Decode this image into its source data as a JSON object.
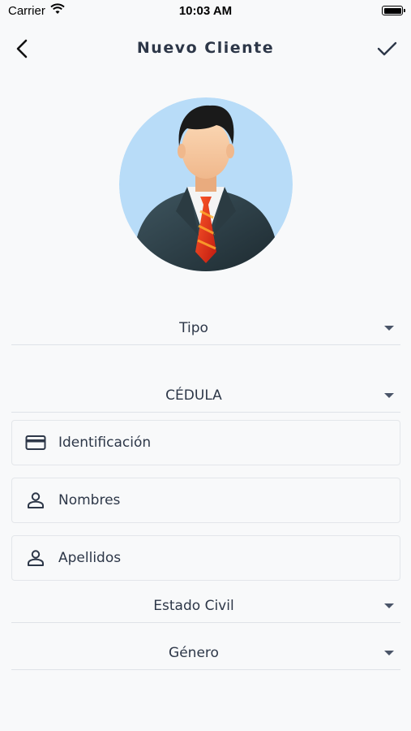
{
  "status_bar": {
    "carrier": "Carrier",
    "time": "10:03 AM"
  },
  "nav": {
    "title": "Nuevo Cliente",
    "back_icon": "chevron-left-icon",
    "confirm_icon": "checkmark-icon"
  },
  "avatar": {
    "icon": "businessman-avatar",
    "background_color": "#b8dcf8"
  },
  "form": {
    "tipo_dropdown": {
      "label": "Tipo"
    },
    "document_dropdown": {
      "label": "CÉDULA"
    },
    "identificacion": {
      "placeholder": "Identificación",
      "icon": "credit-card-icon"
    },
    "nombres": {
      "placeholder": "Nombres",
      "icon": "person-icon"
    },
    "apellidos": {
      "placeholder": "Apellidos",
      "icon": "person-icon"
    },
    "estado_civil_dropdown": {
      "label": "Estado Civil"
    },
    "genero_dropdown": {
      "label": "Género"
    }
  },
  "colors": {
    "background": "#f8f9fa",
    "text": "#2d3748",
    "divider": "#dfe3e8"
  }
}
